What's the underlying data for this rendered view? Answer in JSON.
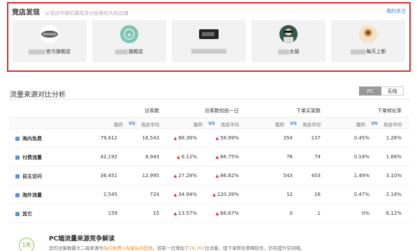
{
  "discover": {
    "title": "竞店发现",
    "subtitle": "从竞店中随机展现支付金额较大的店铺",
    "link": "我的关注",
    "cards": [
      {
        "name": "官方旗舰店"
      },
      {
        "name": "旗舰店"
      },
      {
        "name": ""
      },
      {
        "name": "女装"
      },
      {
        "name": "每天上新"
      }
    ]
  },
  "analysis": {
    "title": "流量来源对比分析",
    "toggle": {
      "pc": "PC",
      "wireless": "无线"
    },
    "headers": [
      "访客数",
      "访客数较前一日",
      "下单买家数",
      "下单转化率"
    ],
    "sub": {
      "mine": "我的",
      "vs": "VS",
      "peer": "竞店平均"
    },
    "rows": [
      {
        "source": "淘内免费",
        "v1": "79,412",
        "v2": "16,543",
        "v3": "88.36%",
        "v4": "58.99%",
        "v5": "354",
        "v6": "237",
        "v7": "0.45%",
        "v8": "1.26%"
      },
      {
        "source": "付费流量",
        "v1": "42,192",
        "v2": "8,943",
        "v3": "6.12%",
        "v4": "66.75%",
        "v5": "76",
        "v6": "74",
        "v7": "0.18%",
        "v8": "1.66%"
      },
      {
        "source": "自主访问",
        "v1": "36,451",
        "v2": "12,995",
        "v3": "27.28%",
        "v4": "86.82%",
        "v5": "543",
        "v6": "403",
        "v7": "1.49%",
        "v8": "3.10%"
      },
      {
        "source": "淘外流量",
        "v1": "2,545",
        "v2": "724",
        "v3": "34.94%",
        "v4": "120.39%",
        "v5": "12",
        "v6": "16",
        "v7": "0.47%",
        "v8": "2.18%"
      },
      {
        "source": "其它",
        "v1": "159",
        "v2": "15",
        "v3": "13.57%",
        "v4": "66.67%",
        "v5": "0",
        "v6": "1",
        "v7": "0%",
        "v8": "6.12%"
      }
    ]
  },
  "insight": {
    "badge": "1天",
    "title": "PC端流量来源竞争解读",
    "text_a": "您的访客数最大二级来源为",
    "text_hl": "淘内免费>淘宝站内其他",
    "text_b": "，较前一日增加了",
    "text_num": "29,767",
    "text_c": "位访客，但下单转化率略较长，仍有提升空间哦。"
  },
  "colors": {
    "frame": "#e4262c",
    "link": "#3a7bd5",
    "accent": "#f08a24"
  }
}
